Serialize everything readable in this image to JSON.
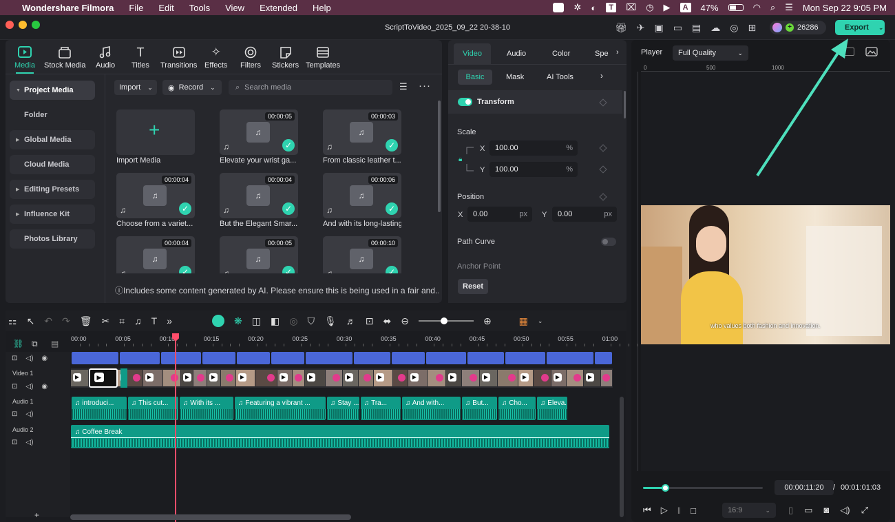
{
  "menubar": {
    "app": "Wondershare Filmora",
    "items": [
      "File",
      "Edit",
      "Tools",
      "View",
      "Extended",
      "Help"
    ],
    "battery": "47%",
    "datetime": "Mon Sep 22  9:05 PM"
  },
  "window": {
    "title": "ScriptToVideo_2025_09_22 20-38-10",
    "credits": "26286",
    "export_label": "Export"
  },
  "media_tabs": [
    {
      "label": "Media",
      "icon": "media-icon"
    },
    {
      "label": "Stock Media",
      "icon": "stock-media-icon"
    },
    {
      "label": "Audio",
      "icon": "audio-icon"
    },
    {
      "label": "Titles",
      "icon": "titles-icon"
    },
    {
      "label": "Transitions",
      "icon": "transitions-icon"
    },
    {
      "label": "Effects",
      "icon": "effects-icon"
    },
    {
      "label": "Filters",
      "icon": "filters-icon"
    },
    {
      "label": "Stickers",
      "icon": "stickers-icon"
    },
    {
      "label": "Templates",
      "icon": "templates-icon"
    }
  ],
  "sidebar": [
    "Project Media",
    "Folder",
    "Global Media",
    "Cloud Media",
    "Editing Presets",
    "Influence Kit",
    "Photos Library"
  ],
  "toolbar": {
    "import": "Import",
    "record": "Record",
    "search_placeholder": "Search media"
  },
  "media": {
    "import_label": "Import Media",
    "items": [
      {
        "dur": "00:00:05",
        "label": "Elevate your wrist ga..."
      },
      {
        "dur": "00:00:03",
        "label": "From classic leather t..."
      },
      {
        "dur": "00:00:04",
        "label": "Choose from a variet..."
      },
      {
        "dur": "00:00:04",
        "label": "But the Elegant Smar..."
      },
      {
        "dur": "00:00:06",
        "label": "And with its long-lasting"
      },
      {
        "dur": "00:00:04",
        "label": ""
      },
      {
        "dur": "00:00:05",
        "label": ""
      },
      {
        "dur": "00:00:10",
        "label": ""
      }
    ],
    "notice": "Includes some content generated by AI. Please ensure this is being used in a fair and.."
  },
  "props": {
    "tabs": [
      "Video",
      "Audio",
      "Color",
      "Spe"
    ],
    "subtabs": [
      "Basic",
      "Mask",
      "AI Tools"
    ],
    "transform": "Transform",
    "scale": "Scale",
    "x": "X",
    "y": "Y",
    "scale_x": "100.00",
    "scale_y": "100.00",
    "pct": "%",
    "position": "Position",
    "pos_x": "0.00",
    "pos_y": "0.00",
    "px": "px",
    "path_curve": "Path Curve",
    "anchor": "Anchor Point",
    "reset": "Reset"
  },
  "player": {
    "label": "Player",
    "quality": "Full Quality",
    "ruler": [
      "0",
      "500",
      "1000"
    ],
    "caption": "who values both fashion and innovation.",
    "time": "00:00:11:20",
    "sep": "/",
    "total": "00:01:01:03",
    "ratio": "16:9",
    "progress": 0.19
  },
  "timeline": {
    "ticks": [
      "00:00",
      "00:05",
      "00:10",
      "00:15",
      "00:20",
      "00:25",
      "00:30",
      "00:35",
      "00:40",
      "00:45",
      "00:50",
      "00:55",
      "01:00"
    ],
    "tracks": [
      "Video 1",
      "Audio 1",
      "Audio 2"
    ],
    "audio1": [
      "introduci...",
      "This cut...",
      "With its ...",
      "Featuring a vibrant ...",
      "Stay ...",
      "Tra...",
      "And with...",
      "But...",
      "Cho...",
      "Eleva..."
    ],
    "audio2": "Coffee Break",
    "playhead": "00:00:10",
    "plus": "+"
  },
  "colors": {
    "accent": "#2fd3b0",
    "menubar": "#5a2f45",
    "clip_video": "#4a67d8",
    "clip_audio": "#0f9b87"
  }
}
